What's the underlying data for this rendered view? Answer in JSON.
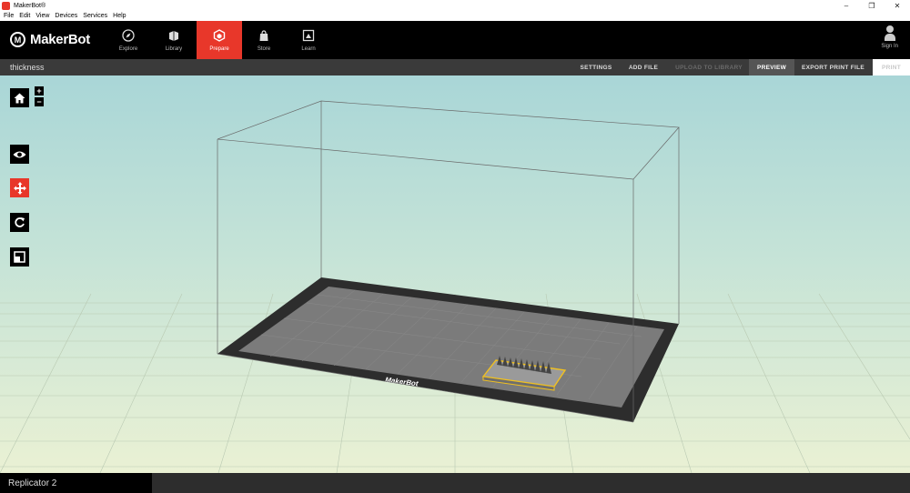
{
  "window": {
    "title": "MakerBot®"
  },
  "menu": [
    "File",
    "Edit",
    "View",
    "Devices",
    "Services",
    "Help"
  ],
  "nav": {
    "logo_text": "MakerBot",
    "tabs": [
      {
        "label": "Explore",
        "icon": "compass-icon"
      },
      {
        "label": "Library",
        "icon": "library-icon"
      },
      {
        "label": "Prepare",
        "icon": "prepare-icon",
        "active": true
      },
      {
        "label": "Store",
        "icon": "store-icon"
      },
      {
        "label": "Learn",
        "icon": "learn-icon"
      }
    ],
    "signin_label": "Sign In"
  },
  "toolbar": {
    "file_name": "thickness",
    "settings": "SETTINGS",
    "add_file": "ADD FILE",
    "upload": "UPLOAD TO LIBRARY",
    "preview": "PREVIEW",
    "export": "EXPORT PRINT FILE",
    "print": "PRINT"
  },
  "viewport": {
    "plate_logo": "MakerBot",
    "tools": [
      "home-icon",
      "zoom-in",
      "zoom-out",
      "view-icon",
      "move-icon",
      "rotate-icon",
      "scale-icon"
    ],
    "zoom_in": "+",
    "zoom_out": "−"
  },
  "status": {
    "printer": "Replicator 2"
  },
  "colors": {
    "accent": "#e8372a",
    "plate": "#7a7a7a",
    "model_outline": "#f0c020"
  }
}
